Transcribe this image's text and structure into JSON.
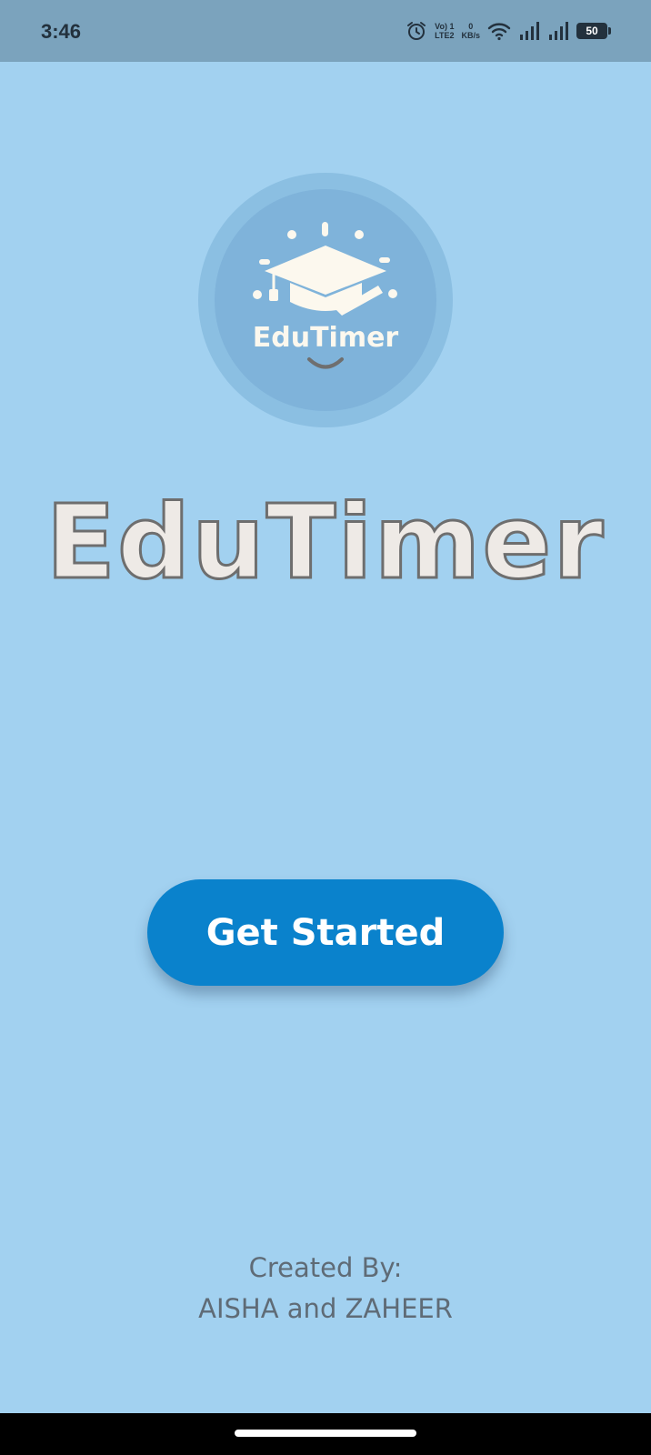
{
  "status_bar": {
    "time": "3:46",
    "volte_line1": "Vo) 1",
    "volte_line2": "LTE2",
    "speed_value": "0",
    "speed_unit": "KB/s",
    "battery": "50"
  },
  "logo": {
    "text": "EduTimer",
    "icon": "graduation-cap-icon"
  },
  "title": "EduTimer",
  "get_started_label": "Get Started",
  "credits": {
    "line1": "Created By:",
    "line2": "AISHA and ZAHEER"
  },
  "colors": {
    "background": "#a2d1f0",
    "status_bar": "#7ba3bd",
    "button": "#0a82cc",
    "logo_outer": "#8bbfe2",
    "logo_inner": "#7fb3da"
  }
}
